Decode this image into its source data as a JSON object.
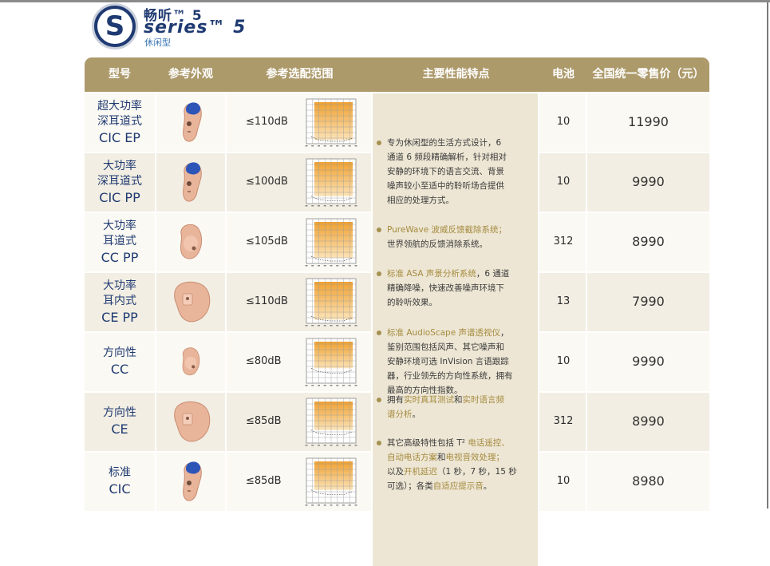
{
  "brand": {
    "name_cn": "畅听™ 5",
    "series": "series™ 5",
    "subtitle": "休闲型",
    "logo_letter": "S"
  },
  "table": {
    "headers": [
      "型号",
      "参考外观",
      "参考选配范围",
      "主要性能特点",
      "电池",
      "全国统一零售价（元）"
    ],
    "rows": [
      {
        "model_cn": [
          "超大功率",
          "深耳道式"
        ],
        "code": "CIC EP",
        "aid": "cic-blue",
        "range": "≤110dB",
        "fill_level_db": 110,
        "battery": "10",
        "price": "11990"
      },
      {
        "model_cn": [
          "大功率",
          "深耳道式"
        ],
        "code": "CIC PP",
        "aid": "cic-blue",
        "range": "≤100dB",
        "fill_level_db": 100,
        "battery": "10",
        "price": "9990"
      },
      {
        "model_cn": [
          "大功率",
          "耳道式"
        ],
        "code": "CC PP",
        "aid": "cc-skin",
        "range": "≤105dB",
        "fill_level_db": 105,
        "battery": "312",
        "price": "8990"
      },
      {
        "model_cn": [
          "大功率",
          "耳内式"
        ],
        "code": "CE PP",
        "aid": "ce-skin",
        "range": "≤110dB",
        "fill_level_db": 110,
        "battery": "13",
        "price": "7990"
      },
      {
        "model_cn": [
          "方向性"
        ],
        "code": "CC",
        "aid": "cc-skin-small",
        "range": "≤80dB",
        "fill_level_db": 80,
        "battery": "10",
        "price": "9990"
      },
      {
        "model_cn": [
          "方向性"
        ],
        "code": "CE",
        "aid": "ce-skin",
        "range": "≤85dB",
        "fill_level_db": 85,
        "battery": "312",
        "price": "8990"
      },
      {
        "model_cn": [
          "标准"
        ],
        "code": "CIC",
        "aid": "cic-blue",
        "range": "≤85dB",
        "fill_level_db": 85,
        "battery": "10",
        "price": "8980"
      }
    ],
    "features": [
      {
        "lines": [
          "专为休闲型的生活方式设计，6",
          "通道 6 频段精确解析，针对相对",
          "安静的环境下的语言交流、背景",
          "噪声较小至适中的聆听场合提供",
          "相应的处理方式。"
        ]
      },
      {
        "lines": [
          "PureWave 波威反馈截除系统；",
          "世界领航的反馈消除系统。"
        ]
      },
      {
        "lines": [
          "标准 ASA 声景分析系统，6 通道",
          "精确降噪，快速改善噪声环境下",
          "的聆听效果。"
        ]
      },
      {
        "lines": [
          "标准 AudioScape 声谱透视仪，",
          "鉴别范围包括风声、其它噪声和",
          "安静环境可选 InVision 言语跟踪",
          "器，行业领先的方向性系统，拥有",
          "最高的方向性指数。"
        ]
      },
      {
        "lines": [
          "拥有实时真耳测试和实时语言频",
          "谱分析。"
        ]
      },
      {
        "lines": [
          "其它高级特性包括 T² 电话遥控、",
          "自动电话方案和电视音效处理；",
          "以及开机延迟（1 秒，7 秒，15 秒",
          "可选）；各类自适应提示音。"
        ]
      }
    ]
  },
  "colors": {
    "header_bg": "#ad9a6b",
    "brand_blue": "#1f3a72",
    "chart_orange": "#f0a130",
    "highlight": "#a58b3f"
  }
}
